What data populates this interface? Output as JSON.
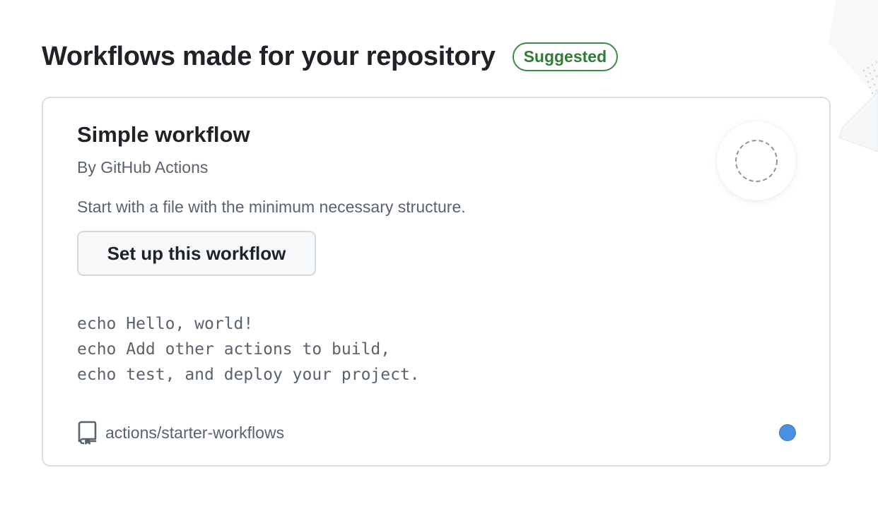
{
  "page": {
    "heading": "Workflows made for your repository",
    "badge": "Suggested"
  },
  "card": {
    "title": "Simple workflow",
    "author": "By GitHub Actions",
    "description": "Start with a file with the minimum necessary structure.",
    "button_label": "Set up this workflow",
    "code_lines": [
      "echo Hello, world!",
      "echo Add other actions to build,",
      "echo test, and deploy your project."
    ],
    "repo": "actions/starter-workflows",
    "logo_icon": "dashed-circle-icon",
    "repo_icon": "repo-icon",
    "language_color": "#4a90e2"
  },
  "colors": {
    "badge_green": "#2e7d34",
    "muted_text": "#59636e",
    "border": "#d8dee4",
    "button_bg": "#f6f8fa"
  }
}
